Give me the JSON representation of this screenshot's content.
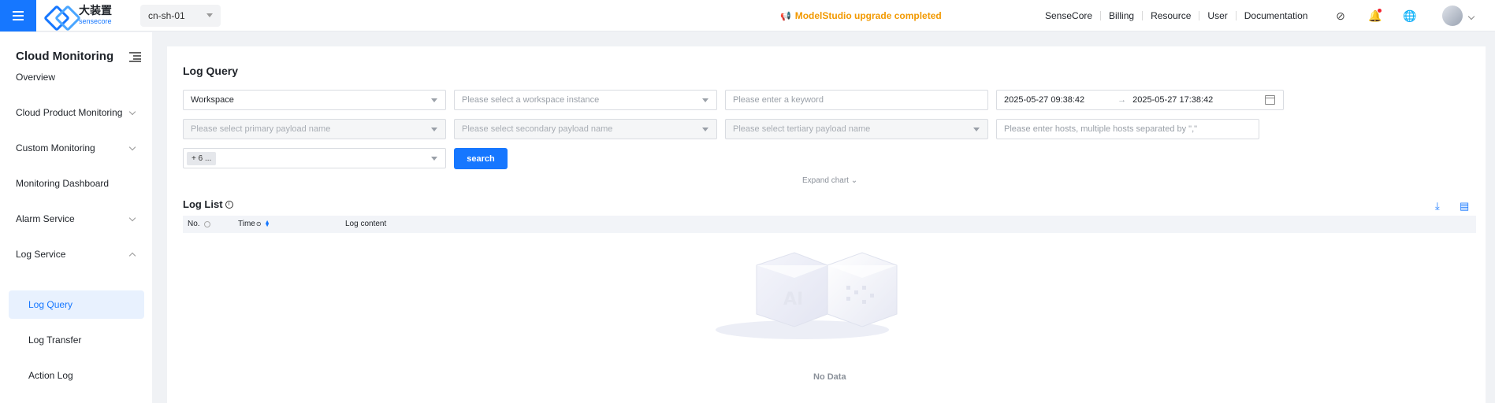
{
  "header": {
    "logo_cn": "大装置",
    "logo_en": "sensecore",
    "region": "cn-sh-01",
    "notice": "ModelStudio upgrade completed",
    "nav": [
      "SenseCore",
      "Billing",
      "Resource",
      "User",
      "Documentation"
    ],
    "icons": [
      "menu-icon",
      "compass-icon",
      "bell-icon",
      "globe-icon",
      "avatar"
    ],
    "accent_color": "#1677ff",
    "notice_color": "#f29900"
  },
  "sidebar": {
    "title": "Cloud Monitoring",
    "items": [
      {
        "label": "Overview"
      },
      {
        "label": "Cloud Product Monitoring",
        "expandable": true
      },
      {
        "label": "Custom Monitoring",
        "expandable": true
      },
      {
        "label": "Monitoring Dashboard"
      },
      {
        "label": "Alarm Service",
        "expandable": true
      },
      {
        "label": "Log Service",
        "expandable": true,
        "expanded": true
      }
    ],
    "sub_items": [
      {
        "label": "Log Query",
        "active": true
      },
      {
        "label": "Log Transfer"
      },
      {
        "label": "Action Log"
      }
    ]
  },
  "main": {
    "title": "Log Query",
    "filters": {
      "workspace_type": "Workspace",
      "workspace_instance_placeholder": "Please select a workspace instance",
      "keyword_placeholder": "Please enter a keyword",
      "date_start": "2025-05-27 09:38:42",
      "date_sep": "→",
      "date_end": "2025-05-27 17:38:42",
      "primary_payload_placeholder": "Please select primary payload name",
      "secondary_payload_placeholder": "Please select secondary payload name",
      "tertiary_payload_placeholder": "Please select tertiary payload name",
      "hosts_placeholder": "Please enter hosts, multiple hosts separated by \",\"",
      "multi_tag": "+ 6 ..."
    },
    "search_label": "search",
    "expand_label": "Expand chart",
    "list_title": "Log List",
    "columns": [
      "No.",
      "Time",
      "Log content"
    ],
    "empty_text": "No Data"
  }
}
